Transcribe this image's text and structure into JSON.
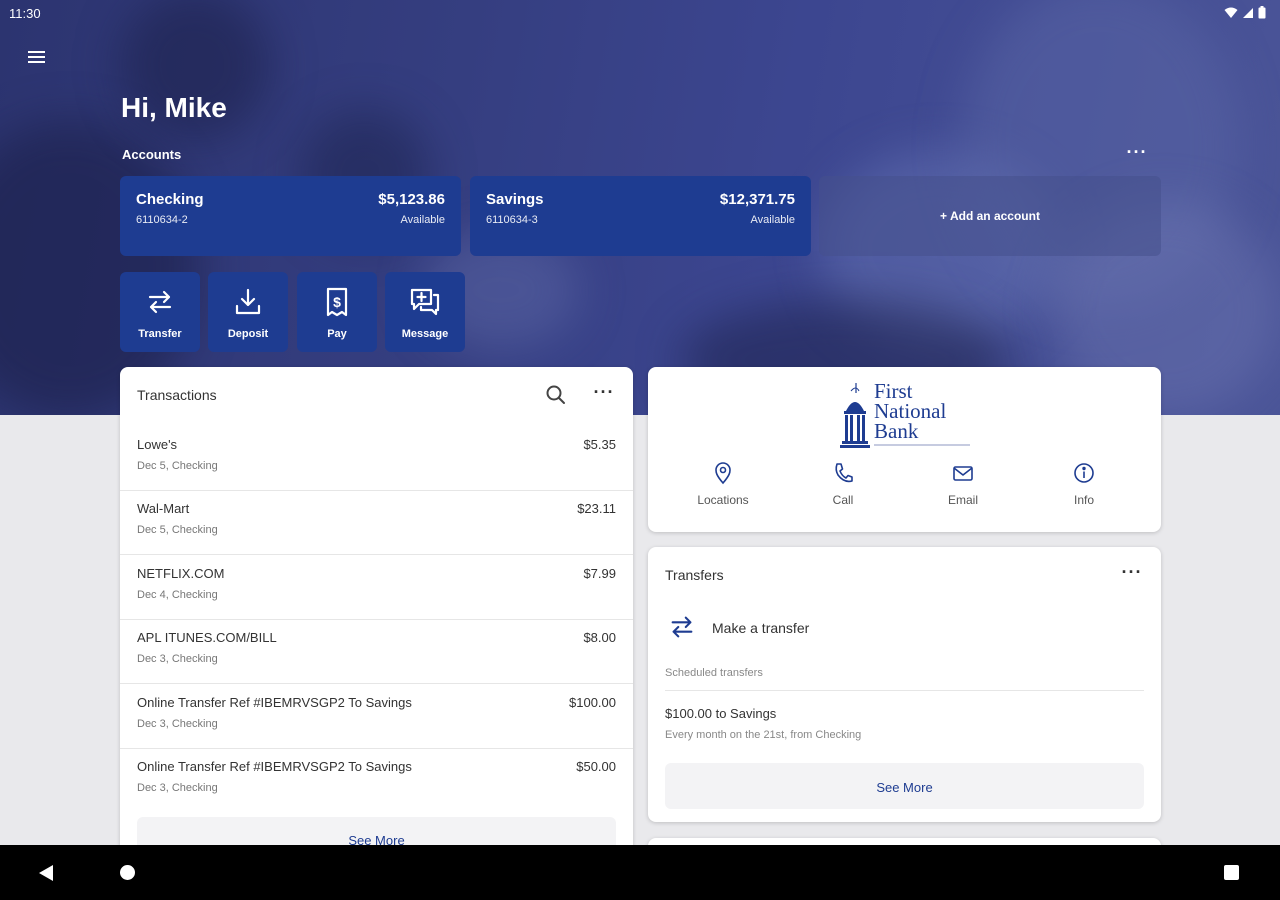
{
  "status_bar": {
    "time": "11:30"
  },
  "greeting": "Hi, Mike",
  "accounts": {
    "label": "Accounts",
    "more_label": "···",
    "items": [
      {
        "name": "Checking",
        "number": "6110634-2",
        "balance": "$5,123.86",
        "balance_label": "Available"
      },
      {
        "name": "Savings",
        "number": "6110634-3",
        "balance": "$12,371.75",
        "balance_label": "Available"
      }
    ],
    "add_label": "+ Add an account"
  },
  "actions": [
    {
      "label": "Transfer",
      "icon": "transfer-icon"
    },
    {
      "label": "Deposit",
      "icon": "deposit-icon"
    },
    {
      "label": "Pay",
      "icon": "pay-icon"
    },
    {
      "label": "Message",
      "icon": "message-icon"
    }
  ],
  "transactions": {
    "title": "Transactions",
    "more_label": "···",
    "items": [
      {
        "name": "Lowe's",
        "sub": "Dec 5, Checking",
        "amount": "$5.35"
      },
      {
        "name": "Wal-Mart",
        "sub": "Dec 5, Checking",
        "amount": "$23.11"
      },
      {
        "name": "NETFLIX.COM",
        "sub": "Dec 4, Checking",
        "amount": "$7.99"
      },
      {
        "name": "APL ITUNES.COM/BILL",
        "sub": "Dec 3, Checking",
        "amount": "$8.00"
      },
      {
        "name": "Online Transfer Ref #IBEMRVSGP2 To Savings",
        "sub": "Dec 3, Checking",
        "amount": "$100.00"
      },
      {
        "name": "Online Transfer Ref #IBEMRVSGP2 To Savings",
        "sub": "Dec 3, Checking",
        "amount": "$50.00"
      }
    ],
    "see_more": "See More"
  },
  "bank": {
    "logo_lines": [
      "First",
      "National",
      "Bank"
    ],
    "actions": [
      {
        "label": "Locations",
        "icon": "location-pin-icon"
      },
      {
        "label": "Call",
        "icon": "phone-icon"
      },
      {
        "label": "Email",
        "icon": "email-icon"
      },
      {
        "label": "Info",
        "icon": "info-icon"
      }
    ]
  },
  "transfers": {
    "title": "Transfers",
    "more_label": "···",
    "make_transfer": "Make a transfer",
    "scheduled_label": "Scheduled transfers",
    "scheduled": {
      "title": "$100.00 to Savings",
      "sub": "Every month on the 21st, from Checking"
    },
    "see_more": "See More"
  },
  "colors": {
    "brand": "#1e3c91",
    "hero": "#353e80",
    "background": "#e9e9ec"
  }
}
